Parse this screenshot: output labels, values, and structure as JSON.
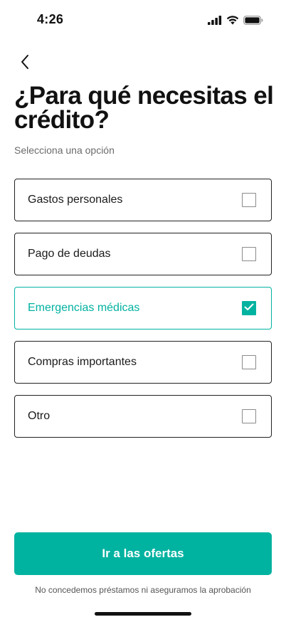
{
  "status_bar": {
    "time": "4:26",
    "icons": [
      "signal-icon",
      "wifi-icon",
      "battery-icon"
    ]
  },
  "header": {
    "back_icon": "chevron-left-icon",
    "title": "¿Para qué necesitas el crédito?",
    "subtitle": "Selecciona una opción"
  },
  "options": [
    {
      "label": "Gastos personales",
      "checked": false
    },
    {
      "label": "Pago de deudas",
      "checked": false
    },
    {
      "label": "Emergencias médicas",
      "checked": true
    },
    {
      "label": "Compras importantes",
      "checked": false
    },
    {
      "label": "Otro",
      "checked": false
    }
  ],
  "cta": {
    "label": "Ir a las ofertas"
  },
  "disclaimer": "No concedemos préstamos ni aseguramos la aprobación",
  "colors": {
    "accent": "#00b2a0",
    "text": "#111111",
    "muted": "#6b6b6b"
  }
}
